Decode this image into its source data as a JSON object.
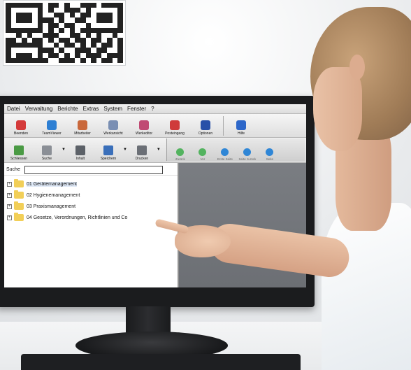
{
  "menu": [
    "Datei",
    "Verwaltung",
    "Berichte",
    "Extras",
    "System",
    "Fenster",
    "?"
  ],
  "toolbar_main": [
    {
      "label": "Beenden",
      "color": "#d43a3a"
    },
    {
      "label": "TeamViewer",
      "color": "#2d7fd3"
    },
    {
      "label": "Mitarbeiter",
      "color": "#c9683b"
    },
    {
      "label": "Werkansicht",
      "color": "#7a8fb3"
    },
    {
      "label": "Werkeditor",
      "color": "#c04a73"
    },
    {
      "label": "Posteingang",
      "color": "#cf3b3b"
    },
    {
      "label": "Optionen",
      "color": "#2850a8"
    },
    {
      "label": "Hilfe",
      "color": "#2d67c9"
    }
  ],
  "toolbar_doc": [
    {
      "label": "Schliessen",
      "color": "#4a9a44"
    },
    {
      "label": "Suche",
      "color": "#8b8f96"
    },
    {
      "label": "Inhalt",
      "color": "#5c6168"
    },
    {
      "label": "Speichern",
      "color": "#3a6fba"
    },
    {
      "label": "Drucken",
      "color": "#6b6f76"
    }
  ],
  "toolbar_nav": [
    {
      "label": "Zurück",
      "color": "#53b35f"
    },
    {
      "label": "Vor",
      "color": "#53b35f"
    },
    {
      "label": "Erste Seite",
      "color": "#2f86d6"
    },
    {
      "label": "Seite zurück",
      "color": "#2f86d6"
    },
    {
      "label": "Seite",
      "color": "#2f86d6"
    }
  ],
  "search": {
    "label": "Suche",
    "value": ""
  },
  "tree": [
    {
      "label": "01 Gerätemanagement",
      "selected": true
    },
    {
      "label": "02 Hygienemanagement",
      "selected": false
    },
    {
      "label": "03 Praxismanagement",
      "selected": false
    },
    {
      "label": "04 Gesetze, Verordnungen, Richtlinien und Co",
      "selected": false
    }
  ]
}
